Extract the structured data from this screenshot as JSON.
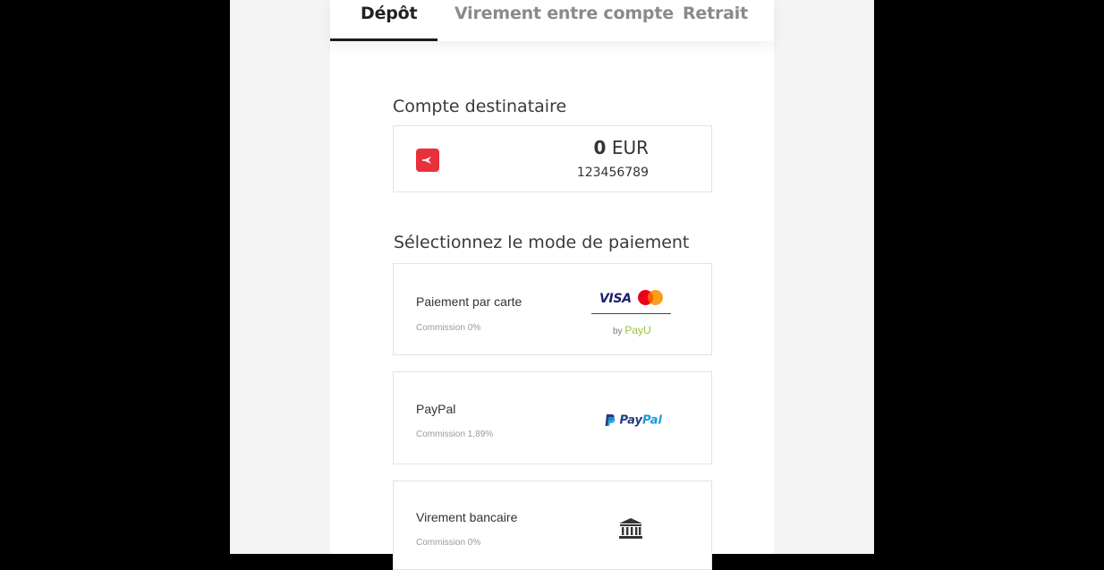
{
  "tabs": [
    {
      "label": "Dépôt",
      "active": true
    },
    {
      "label": "Virement entre compte",
      "active": false
    },
    {
      "label": "Retrait",
      "active": false
    }
  ],
  "recipient": {
    "title": "Compte destinataire",
    "balance_amount": "0",
    "balance_currency": "EUR",
    "account_number": "123456789"
  },
  "payment": {
    "title": "Sélectionnez le mode de paiement",
    "methods": [
      {
        "name": "Paiement par carte",
        "fee": "Commission 0%",
        "logos": [
          "visa-logo",
          "mastercard-logo",
          "payu-logo"
        ]
      },
      {
        "name": "PayPal",
        "fee": "Commission 1,89%",
        "logos": [
          "paypal-logo"
        ]
      },
      {
        "name": "Virement bancaire",
        "fee": "Commission 0%",
        "logos": [
          "bank-icon"
        ]
      }
    ],
    "card_logo_text": {
      "visa": "VISA",
      "by": "by",
      "payu": "PayU"
    },
    "paypal_logo_text": {
      "pay": "Pay",
      "pal": "Pal"
    }
  },
  "colors": {
    "brand_red": "#e8313c",
    "active_tab": "#222222",
    "inactive_tab": "#8a8a8a",
    "visa_blue": "#1a1f71",
    "paypal_dark": "#253b80",
    "paypal_light": "#179bd7",
    "payu_green": "#9bc13c"
  }
}
